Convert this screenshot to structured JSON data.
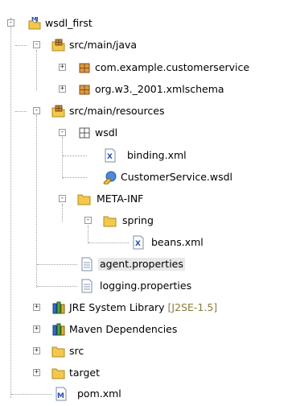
{
  "tree": {
    "rows": [
      {
        "label": "wsdl_first",
        "icon": "maven-project-icon",
        "twisty": "-"
      },
      {
        "label": "src/main/java",
        "icon": "source-folder-icon",
        "twisty": "-"
      },
      {
        "label": "com.example.customerservice",
        "icon": "package-icon",
        "twisty": "+"
      },
      {
        "label": "org.w3._2001.xmlschema",
        "icon": "package-icon",
        "twisty": "+"
      },
      {
        "label": "src/main/resources",
        "icon": "source-folder-icon",
        "twisty": "-"
      },
      {
        "label": "wsdl",
        "icon": "wsdl-folder-icon",
        "twisty": "-"
      },
      {
        "label": "binding.xml",
        "icon": "xml-file-icon",
        "twisty": ""
      },
      {
        "label": "CustomerService.wsdl",
        "icon": "wsdl-file-icon",
        "twisty": ""
      },
      {
        "label": "META-INF",
        "icon": "folder-icon",
        "twisty": "-"
      },
      {
        "label": "spring",
        "icon": "folder-icon",
        "twisty": "-"
      },
      {
        "label": "beans.xml",
        "icon": "xml-file-icon",
        "twisty": ""
      },
      {
        "label": "agent.properties",
        "icon": "properties-file-icon",
        "twisty": "",
        "selected": true
      },
      {
        "label": "logging.properties",
        "icon": "properties-file-icon",
        "twisty": ""
      },
      {
        "label": "JRE System Library",
        "decoration": "[J2SE-1.5]",
        "icon": "library-icon",
        "twisty": "+"
      },
      {
        "label": "Maven Dependencies",
        "icon": "library-icon",
        "twisty": "+"
      },
      {
        "label": "src",
        "icon": "folder-icon",
        "twisty": "+"
      },
      {
        "label": "target",
        "icon": "folder-icon",
        "twisty": "+"
      },
      {
        "label": "pom.xml",
        "icon": "maven-pom-icon",
        "twisty": ""
      }
    ]
  },
  "colors": {
    "selection": "#e8e8e8",
    "decoration": "#8a7c3c",
    "folder": "#f4c84a",
    "guide": "#a0a0a0"
  }
}
